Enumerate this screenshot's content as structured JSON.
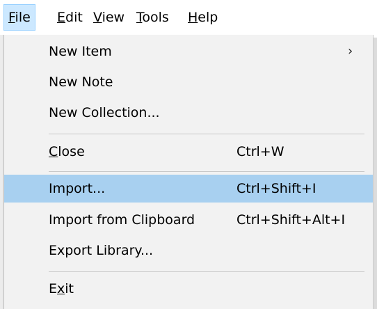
{
  "menubar": {
    "items": [
      {
        "mnemonic": "F",
        "rest": "ile"
      },
      {
        "mnemonic": "E",
        "rest": "dit"
      },
      {
        "mnemonic": "V",
        "rest": "iew"
      },
      {
        "mnemonic": "T",
        "rest": "ools"
      },
      {
        "mnemonic": "H",
        "rest": "elp"
      }
    ]
  },
  "file_menu": {
    "new_item": "New Item",
    "new_item_arrow": "›",
    "new_note": "New Note",
    "new_collection": "New Collection...",
    "close": {
      "mnemonic": "C",
      "rest": "lose",
      "shortcut": "Ctrl+W"
    },
    "import": {
      "label": "Import...",
      "shortcut": "Ctrl+Shift+I"
    },
    "import_clipboard": {
      "label": "Import from Clipboard",
      "shortcut": "Ctrl+Shift+Alt+I"
    },
    "export_library": "Export Library...",
    "exit": {
      "before": "E",
      "mnemonic": "x",
      "rest": "it"
    }
  },
  "colors": {
    "highlight": "#a8d0f0",
    "menubar_active": "#cce8ff",
    "menu_background": "#f2f2f2"
  }
}
